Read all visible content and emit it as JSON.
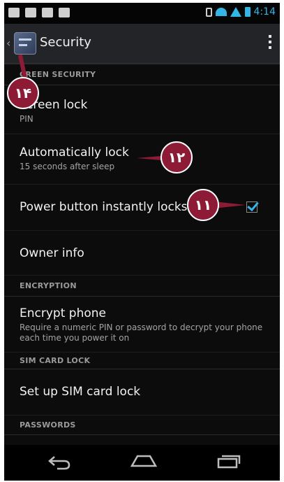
{
  "status_bar": {
    "time": "4:14"
  },
  "action_bar": {
    "title": "Security",
    "up_glyph": "‹"
  },
  "sections": {
    "screen_security": "CREEN SECURITY",
    "encryption": "ENCRYPTION",
    "sim_card_lock": "SIM CARD LOCK",
    "passwords": "PASSWORDS"
  },
  "items": {
    "screen_lock": {
      "title": "creen lock",
      "summary": "PIN"
    },
    "auto_lock": {
      "title": "Automatically lock",
      "summary": "15 seconds after sleep"
    },
    "power_button": {
      "title": "Power button instantly locks",
      "checked": true
    },
    "owner_info": {
      "title": "Owner info"
    },
    "encrypt_phone": {
      "title": "Encrypt phone",
      "summary": "Require a numeric PIN or password to decrypt your phone each time you power it on"
    },
    "sim_lock": {
      "title": "Set up SIM card lock"
    }
  },
  "annotations": {
    "a14": "۱۴",
    "a12": "۱۲",
    "a11": "۱۱"
  },
  "colors": {
    "accent": "#33b5e5",
    "badge": "#8e1b36"
  },
  "icons": [
    "email-icon",
    "message-icon",
    "calendar-icon",
    "gamepad-icon",
    "sim-icon",
    "wifi-icon",
    "signal-icon",
    "battery-icon",
    "settings-app-icon",
    "overflow-menu-icon",
    "back-icon",
    "home-icon",
    "recent-apps-icon"
  ]
}
